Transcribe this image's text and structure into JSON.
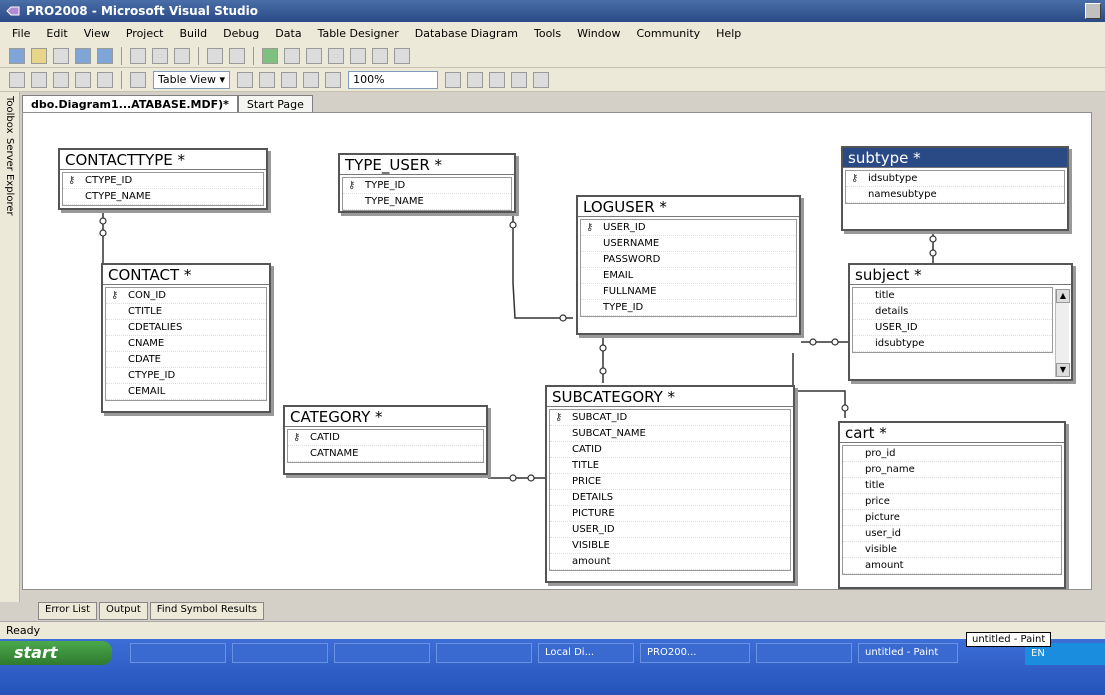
{
  "window": {
    "title": "PRO2008 - Microsoft Visual Studio"
  },
  "menu": [
    "File",
    "Edit",
    "View",
    "Project",
    "Build",
    "Debug",
    "Data",
    "Table Designer",
    "Database Diagram",
    "Tools",
    "Window",
    "Community",
    "Help"
  ],
  "toolbar": {
    "table_view_label": "Table View ▾",
    "zoom_value": "100%"
  },
  "side_panels": {
    "toolbox": "Toolbox",
    "server_explorer": "Server Explorer"
  },
  "doc_tabs": [
    "dbo.Diagram1...ATABASE.MDF)*",
    "Start Page"
  ],
  "tables": {
    "contacttype": {
      "name": "CONTACTTYPE *",
      "columns": [
        "CTYPE_ID",
        "CTYPE_NAME"
      ]
    },
    "type_user": {
      "name": "TYPE_USER *",
      "columns": [
        "TYPE_ID",
        "TYPE_NAME"
      ]
    },
    "subtype": {
      "name": "subtype *",
      "columns": [
        "idsubtype",
        "namesubtype"
      ]
    },
    "loguser": {
      "name": "LOGUSER *",
      "columns": [
        "USER_ID",
        "USERNAME",
        "PASSWORD",
        "EMAIL",
        "FULLNAME",
        "TYPE_ID"
      ]
    },
    "contact": {
      "name": "CONTACT *",
      "columns": [
        "CON_ID",
        "CTITLE",
        "CDETALIES",
        "CNAME",
        "CDATE",
        "CTYPE_ID",
        "CEMAIL"
      ]
    },
    "subject": {
      "name": "subject *",
      "columns": [
        "title",
        "details",
        "USER_ID",
        "idsubtype"
      ]
    },
    "category": {
      "name": "CATEGORY *",
      "columns": [
        "CATID",
        "CATNAME"
      ]
    },
    "subcategory": {
      "name": "SUBCATEGORY *",
      "columns": [
        "SUBCAT_ID",
        "SUBCAT_NAME",
        "CATID",
        "TITLE",
        "PRICE",
        "DETAILS",
        "PICTURE",
        "USER_ID",
        "VISIBLE",
        "amount"
      ]
    },
    "cart": {
      "name": "cart *",
      "columns": [
        "pro_id",
        "pro_name",
        "title",
        "price",
        "picture",
        "user_id",
        "visible",
        "amount"
      ]
    }
  },
  "output_tabs": [
    "Error List",
    "Output",
    "Find Symbol Results"
  ],
  "status": "Ready",
  "taskbar": {
    "start": "start",
    "items": [
      "",
      "",
      "",
      "",
      "Local Di...",
      "PRO200...",
      "",
      "untitled - Paint"
    ],
    "paint_tooltip": "untitled - Paint",
    "tray": "EN"
  },
  "colors": {
    "titlebar": "#2a4a86",
    "selected_table": "#2a4a86",
    "taskbar": "#2453b8"
  }
}
